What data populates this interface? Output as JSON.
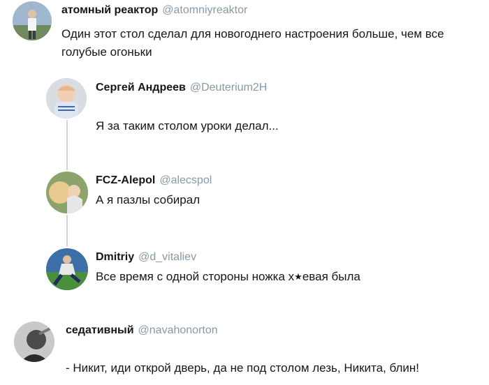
{
  "tweets": [
    {
      "name": "атомный реактор",
      "handle": "@atomniyreaktor",
      "text": "Один этот стол сделал для новогоднего настроения больше, чем все голубые огоньки"
    },
    {
      "name": "Сергей Андреев",
      "handle": "@Deuterium2H",
      "text": "Я за таким столом уроки делал..."
    },
    {
      "name": "FCZ-Alepol",
      "handle": "@alecspol",
      "text": "А я пазлы собирал"
    },
    {
      "name": "Dmitriy",
      "handle": "@d_vitaliev",
      "text_before": "Все время с одной стороны ножка х",
      "censor_glyph": "★",
      "text_after": "евая была"
    },
    {
      "name": "седативный",
      "handle": "@navahonorton",
      "text": "- Никит, иди открой дверь, да не под столом лезь, Никита, блин!"
    }
  ]
}
